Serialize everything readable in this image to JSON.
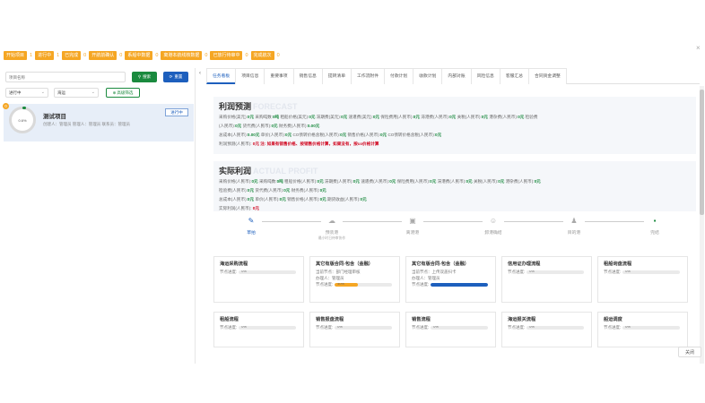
{
  "close_glyph": "×",
  "status_chips": [
    {
      "label": "开始项目",
      "count": "1"
    },
    {
      "label": "进行中",
      "count": "1"
    },
    {
      "label": "已完成",
      "count": "0"
    },
    {
      "label": "开航前确认",
      "count": "0"
    },
    {
      "label": "系船中数据",
      "count": "0"
    },
    {
      "label": "离港本航线核数据",
      "count": "0"
    },
    {
      "label": "已放行待审中",
      "count": "0"
    },
    {
      "label": "完成航次",
      "count": "0"
    }
  ],
  "filters": {
    "search_placeholder": "项目名称",
    "search_label": "搜索",
    "reset_label": "重置",
    "status_value": "进行中",
    "type_value": "海运",
    "advanced_label": "高级筛选"
  },
  "project": {
    "name": "测试项目",
    "meta": "创建人：管理员  管理人：管理员  联系员：管理员",
    "progress_pct": "0.6%",
    "progress_value": 0.006,
    "badge": "0",
    "action_label": "进行中"
  },
  "tabs": [
    "任务看板",
    "项目信息",
    "重要事项",
    "销售信息",
    "提转清单",
    "工作流附件",
    "付款计划",
    "收款计划",
    "内部对账",
    "风险信息",
    "客服汇总",
    "合同资金调整"
  ],
  "forecast": {
    "title": "利润预测",
    "bg_text": "FORECAST",
    "lines": [
      [
        {
          "t": "采购价格(美元):"
        },
        {
          "v": "0元"
        },
        {
          "t": "采购吨数:"
        },
        {
          "v": "0吨"
        },
        {
          "t": "租船价格(美元):"
        },
        {
          "v": "0元"
        },
        {
          "t": "滞期费(美元):"
        },
        {
          "v": "0元"
        },
        {
          "t": "速遣费(美元):"
        },
        {
          "v": "0元"
        },
        {
          "t": "保险费用(人民币):"
        },
        {
          "v": "0元"
        },
        {
          "t": "滞港费(人民币):"
        },
        {
          "v": "0元"
        },
        {
          "t": "关税(人民币):"
        },
        {
          "v": "0元"
        },
        {
          "t": "港杂费(人民币):"
        },
        {
          "v": "0元"
        },
        {
          "t": "检验费"
        }
      ],
      [
        {
          "t": "(人民币):"
        },
        {
          "v": "0元"
        },
        {
          "t": "货代费(人民币):"
        },
        {
          "v": "0元"
        },
        {
          "t": "财务费(人民币):"
        },
        {
          "v": "0.00元"
        }
      ],
      [
        {
          "t": "总成本(人民币):"
        },
        {
          "v": "0.00元"
        },
        {
          "t": "单价(人民币):"
        },
        {
          "v": "0元"
        },
        {
          "t": "CO债转价格含税(人民币):"
        },
        {
          "v": "0元"
        },
        {
          "t": "销售价格(人民币):"
        },
        {
          "v": "0元"
        },
        {
          "t": "CO债转价格含税(人民币):"
        },
        {
          "v": "0元"
        }
      ]
    ],
    "profit_label": "利润预测(人民币):",
    "profit_warn": "0元 注: 如果有销售价格、按销售价格计算，如果没有，按co价格计算"
  },
  "actual": {
    "title": "实际利润",
    "bg_text": "ACTUAL PROFIT",
    "lines": [
      [
        {
          "t": "采购价格(人民币):"
        },
        {
          "v": "0元"
        },
        {
          "t": "采购吨数:"
        },
        {
          "v": "0吨"
        },
        {
          "t": "租船价格(人民币):"
        },
        {
          "v": "0元"
        },
        {
          "t": "滞期费(人民币):"
        },
        {
          "v": "0元"
        },
        {
          "t": "速遣费(人民币):"
        },
        {
          "v": "0元"
        },
        {
          "t": "保险费用(人民币):"
        },
        {
          "v": "0元"
        },
        {
          "t": "滞港费(人民币):"
        },
        {
          "v": "0元"
        },
        {
          "t": "关税(人民币):"
        },
        {
          "v": "0元"
        },
        {
          "t": "港杂费(人民币):"
        },
        {
          "v": "0元"
        }
      ],
      [
        {
          "t": "检验费(人民币):"
        },
        {
          "v": "0元"
        },
        {
          "t": "货代费(人民币):"
        },
        {
          "v": "0元"
        },
        {
          "t": "财务费(人民币):"
        },
        {
          "v": "0元"
        }
      ],
      [
        {
          "t": "总成本(人民币):"
        },
        {
          "v": "0元"
        },
        {
          "t": "单价(人民币):"
        },
        {
          "v": "0元"
        },
        {
          "t": "销售价格(人民币):"
        },
        {
          "v": "0元"
        },
        {
          "t": "期货收益(人民币):"
        },
        {
          "v": "0元"
        }
      ]
    ],
    "profit_label": "实际利润(人民币):",
    "profit_value": "0元"
  },
  "steps": [
    {
      "icon": "✎",
      "icon_name": "edit-icon",
      "label": "草拍",
      "state": "done",
      "sub": ""
    },
    {
      "icon": "☁",
      "icon_name": "cloud-icon",
      "label": "预装港",
      "state": "todo",
      "sub": "最小时日待审协作"
    },
    {
      "icon": "▣",
      "icon_name": "file-icon",
      "label": "离港港",
      "state": "todo",
      "sub": ""
    },
    {
      "icon": "☺",
      "icon_name": "smile-icon",
      "label": "卸港确结",
      "state": "todo",
      "sub": ""
    },
    {
      "icon": "♟",
      "icon_name": "person-icon",
      "label": "目的港",
      "state": "todo",
      "sub": ""
    },
    {
      "icon": "▪",
      "icon_name": "flag-icon",
      "label": "完结",
      "state": "green",
      "sub": ""
    }
  ],
  "cards_row1": [
    {
      "title": "海运采购流程",
      "lines": [],
      "progress_label": "节点进度:",
      "progress_text": "0%",
      "progress": 0,
      "color": "#cccccc"
    },
    {
      "title": "其它有版合同-包含（金融）",
      "lines": [
        "当前节点：部门经理审核",
        "办理人：管理员"
      ],
      "progress_label": "节点进度:",
      "progress_text": "40%",
      "progress": 0.4,
      "color": "#f5a623"
    },
    {
      "title": "其它有版合同-包含（金融）",
      "lines": [
        "当前节点：上传双盖扫卡",
        "办理人：管理员"
      ],
      "progress_label": "节点进度:",
      "progress_text": "",
      "progress": 1.0,
      "color": "#1d5fbd"
    },
    {
      "title": "信用证办理流程",
      "lines": [],
      "progress_label": "节点进度:",
      "progress_text": "0%",
      "progress": 0,
      "color": "#cccccc"
    },
    {
      "title": "租船询盘流程",
      "lines": [],
      "progress_label": "节点进度:",
      "progress_text": "0%",
      "progress": 0,
      "color": "#cccccc"
    }
  ],
  "cards_row2": [
    {
      "title": "租船流程",
      "progress_label": "节点进度:",
      "progress_text": "0%",
      "progress": 0
    },
    {
      "title": "销售报盘流程",
      "progress_label": "节点进度:",
      "progress_text": "0%",
      "progress": 0
    },
    {
      "title": "销售流程",
      "progress_label": "节点进度:",
      "progress_text": "0%",
      "progress": 0
    },
    {
      "title": "海运报关流程",
      "progress_label": "节点进度:",
      "progress_text": "0%",
      "progress": 0
    },
    {
      "title": "船运调度",
      "progress_label": "节点进度:",
      "progress_text": "0%",
      "progress": 0
    }
  ],
  "close_button": "关闭"
}
